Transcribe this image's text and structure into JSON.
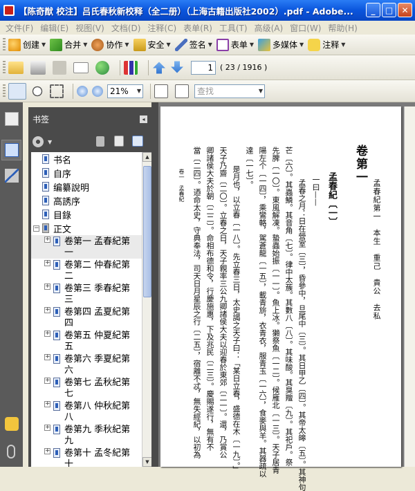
{
  "window": {
    "title": "【陈奇猷 校注】吕氏春秋新校释（全二册）（上海古籍出版社2002）.pdf - Adobe...",
    "buttons": [
      "_",
      "□",
      "✕"
    ]
  },
  "menu": [
    "文件(F)",
    "编辑(E)",
    "视图(V)",
    "文档(D)",
    "注释(C)",
    "表单(R)",
    "工具(T)",
    "高级(A)",
    "窗口(W)",
    "帮助(H)"
  ],
  "toolbar1": {
    "create": "创建",
    "combine": "合并",
    "collaborate": "协作",
    "secure": "安全",
    "sign": "签名",
    "forms": "表单",
    "multimedia": "多媒体",
    "comment": "注释"
  },
  "toolbar2": {
    "page_number": "1",
    "page_count": "( 23 / 1916 )"
  },
  "toolbar3": {
    "zoom": "21%",
    "search_placeholder": "查找"
  },
  "panel": {
    "title": "书签",
    "bookmarks": [
      {
        "label": "书名",
        "level": 0
      },
      {
        "label": "自序",
        "level": 0
      },
      {
        "label": "编纂說明",
        "level": 0
      },
      {
        "label": "高誘序",
        "level": 0
      },
      {
        "label": "目錄",
        "level": 0
      },
      {
        "label": "正文",
        "level": 0
      },
      {
        "label": "卷第一 孟春紀第一",
        "level": 1
      },
      {
        "label": "卷第二 仲春紀第二",
        "level": 1
      },
      {
        "label": "卷第三 季春紀第三",
        "level": 1
      },
      {
        "label": "卷第四 孟夏紀第四",
        "level": 1
      },
      {
        "label": "卷第五 仲夏紀第五",
        "level": 1
      },
      {
        "label": "卷第六 季夏紀第六",
        "level": 1
      },
      {
        "label": "卷第七 孟秋紀第七",
        "level": 1
      },
      {
        "label": "卷第八 仲秋紀第八",
        "level": 1
      },
      {
        "label": "卷第九 季秋紀第九",
        "level": 1
      },
      {
        "label": "卷第十 孟冬紀第十",
        "level": 1
      }
    ]
  },
  "document": {
    "heading": "卷第一",
    "subheading": "孟春紀第一　本生　重己　貴公　去私",
    "chapter": "孟春紀〔一〕",
    "section": "一曰——",
    "columns": [
      "孟春之月：日在營室〔三〕，昏參中，旦尾中〔三〕。其日甲乙〔四〕。其帝太皞〔五〕。其神句",
      "芒〔六〕。其蟲鱗。其音角〔七〕。律中太蔟。其數八〔八〕。其味酸。其臭羶〔九〕。其祀戶。祭",
      "先脾〔一〇〕。東風解凍。蟄蟲始振〔一一〕。魚上冰。獺祭魚〔一二〕。候雁北〔一三〕。天子居青",
      "陽左个〔一四〕，乘鸞輅，駕蒼龍〔一五〕，載青旂，衣青衣，服青玉〔一六〕，食麥與羊。其器疏以",
      "達〔一七〕。",
      "是月也，以立春〔一八〕。先立春三日，太史謁之天子曰：「某日立春，盛德在木〔一九〕。」",
      "天子乃齋〔二〇〕。立春之日，天子親率三公九卿諸侯大夫以迎春於東郊〔二一〕。還，乃賞公",
      "卿諸侯大夫於朝〔二二〕。命相布德和令，行慶施惠，下及兆民〔二三〕。慶賜遂行，無有不",
      "當〔二四〕。迺命太史，守典奉法，司天日月星辰之行〔二五〕，宿離不忒，無失經紀，以初為"
    ],
    "margin_note": "卷一　孟春紀"
  }
}
